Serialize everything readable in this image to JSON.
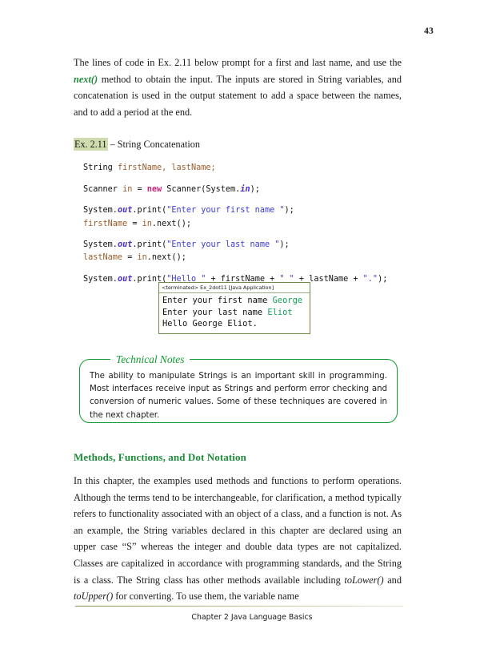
{
  "page": {
    "number": "43",
    "footer_text": "Chapter 2 Java Language Basics"
  },
  "intro_paragraph": {
    "part1": "The lines of code in Ex. 2.11 below prompt for a first and last name, and use the ",
    "code_term": "next()",
    "part2": " method to obtain the input.  The inputs are stored in String variables, and concatenation is used in the output statement to add a space between the names, and to add a period at the end."
  },
  "example": {
    "label": "Ex. 2.11",
    "title": " – String Concatenation",
    "highlight_color": "#cfdcae"
  },
  "code": {
    "lines": [
      [
        {
          "t": "String ",
          "c": "c-plain"
        },
        {
          "t": "firstName, lastName;",
          "c": "c-var"
        }
      ],
      [
        {
          "t": "Scanner ",
          "c": "c-plain"
        },
        {
          "t": "in",
          "c": "c-var"
        },
        {
          "t": " = ",
          "c": "c-plain"
        },
        {
          "t": "new",
          "c": "c-kw"
        },
        {
          "t": " Scanner(System.",
          "c": "c-plain"
        },
        {
          "t": "in",
          "c": "c-field"
        },
        {
          "t": ");",
          "c": "c-plain"
        }
      ],
      [
        {
          "t": "System.",
          "c": "c-plain"
        },
        {
          "t": "out",
          "c": "c-field"
        },
        {
          "t": ".print(",
          "c": "c-plain"
        },
        {
          "t": "\"Enter your first name \"",
          "c": "c-str"
        },
        {
          "t": ");",
          "c": "c-plain"
        }
      ],
      [
        {
          "t": "firstName",
          "c": "c-var"
        },
        {
          "t": " = ",
          "c": "c-plain"
        },
        {
          "t": "in",
          "c": "c-var"
        },
        {
          "t": ".next();",
          "c": "c-plain"
        }
      ],
      [
        {
          "t": "System.",
          "c": "c-plain"
        },
        {
          "t": "out",
          "c": "c-field"
        },
        {
          "t": ".print(",
          "c": "c-plain"
        },
        {
          "t": "\"Enter your last name \"",
          "c": "c-str"
        },
        {
          "t": ");",
          "c": "c-plain"
        }
      ],
      [
        {
          "t": "lastName",
          "c": "c-var"
        },
        {
          "t": " = ",
          "c": "c-plain"
        },
        {
          "t": "in",
          "c": "c-var"
        },
        {
          "t": ".next();",
          "c": "c-plain"
        }
      ],
      [
        {
          "t": "System.",
          "c": "c-plain"
        },
        {
          "t": "out",
          "c": "c-field"
        },
        {
          "t": ".print(",
          "c": "c-plain"
        },
        {
          "t": "\"Hello \"",
          "c": "c-str"
        },
        {
          "t": " + firstName + ",
          "c": "c-plain"
        },
        {
          "t": "\" \"",
          "c": "c-str"
        },
        {
          "t": " + lastName + ",
          "c": "c-plain"
        },
        {
          "t": "\".\"",
          "c": "c-str"
        },
        {
          "t": ");",
          "c": "c-plain"
        }
      ]
    ],
    "groups": [
      1,
      1,
      2,
      2,
      1
    ]
  },
  "console": {
    "title": "<terminated> Ex_2dot11 [Java Application]",
    "lines": [
      {
        "prompt": "Enter your first name ",
        "input": "George"
      },
      {
        "prompt": "Enter your last name ",
        "input": "Eliot"
      },
      {
        "prompt": "Hello George Eliot.",
        "input": ""
      }
    ],
    "input_color": "#14a05a",
    "border_color": "#6e8b4a"
  },
  "technical_notes": {
    "title": "Technical Notes",
    "body": "The ability to manipulate Strings is an important skill in programming.  Most interfaces receive input as Strings and perform error checking and conversion of numeric values.   Some of these techniques are covered in the next chapter.",
    "accent_color": "#0f9b2e"
  },
  "section": {
    "heading": "Methods, Functions, and Dot Notation",
    "heading_color": "#1e8c3a",
    "paragraph_part1": "In this chapter, the examples used methods and functions to perform operations.  Although the terms tend to be interchangeable, for clarification, a method typically refers to functionality associated with an object of a class, and a function is not.  As an example, the String variables declared in this chapter are declared using an upper case “S” whereas the integer and double data types are not capitalized.  Classes are capitalized in accordance with programming standards, and the String is a class.  The String class has other methods available including ",
    "method1": "toLower()",
    "paragraph_part2": " and ",
    "method2": "toUpper()",
    "paragraph_part3": " for converting.  To use them, the variable name"
  }
}
